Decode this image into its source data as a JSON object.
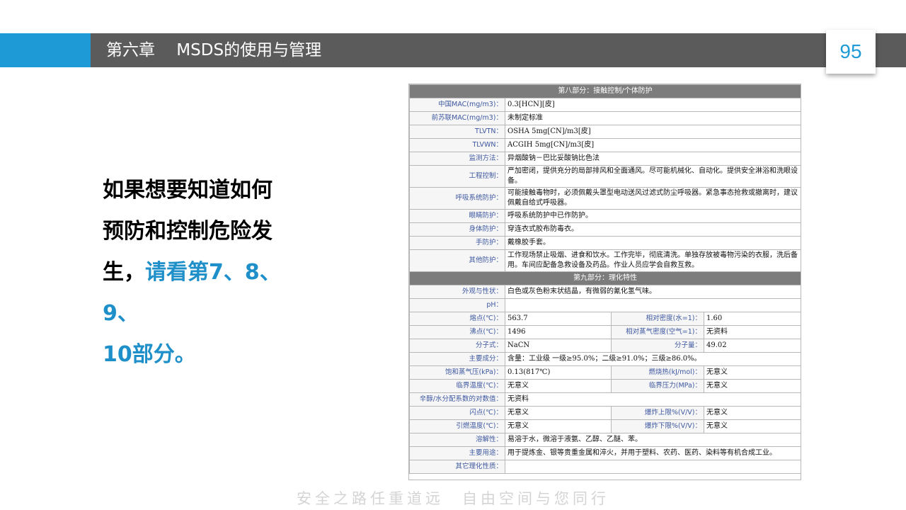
{
  "header": {
    "chapter_title": "第六章　 MSDS的使用与管理",
    "page_number": "95"
  },
  "main_text": {
    "line1": "如果想要知道如何",
    "line2": "预防和控制危险发",
    "line3_plain": "生，",
    "line3_highlight": "请看第7、8、9、",
    "line4_highlight": "10部分。"
  },
  "msds": {
    "section8_title": "第八部分：接触控制/个体防护",
    "section8_rows": [
      {
        "label": "中国MAC(mg/m3)：",
        "value": "0.3[HCN][皮]"
      },
      {
        "label": "前苏联MAC(mg/m3)：",
        "value": "未制定标准"
      },
      {
        "label": "TLVTN：",
        "value": "OSHA 5mg[CN]/m3[皮]"
      },
      {
        "label": "TLVWN：",
        "value": "ACGIH 5mg[CN]/m3[皮]"
      },
      {
        "label": "监测方法：",
        "value": "异烟酸钠－巴比妥酸钠比色法"
      },
      {
        "label": "工程控制：",
        "value": "严加密闭，提供充分的局部排风和全面通风。尽可能机械化、自动化。提供安全淋浴和洗眼设备。"
      },
      {
        "label": "呼吸系统防护：",
        "value": "可能接触毒物时，必须佩戴头罩型电动送风过滤式防尘呼吸器。紧急事态抢救或撤离时，建议佩戴自给式呼吸器。"
      },
      {
        "label": "眼睛防护：",
        "value": "呼吸系统防护中已作防护。"
      },
      {
        "label": "身体防护：",
        "value": "穿连衣式胶布防毒衣。"
      },
      {
        "label": "手防护：",
        "value": "戴橡胶手套。"
      },
      {
        "label": "其他防护：",
        "value": "工作现场禁止吸烟、进食和饮水。工作完毕，彻底清洗。单独存放被毒物污染的衣服，洗后备用。车间应配备急救设备及药品。作业人员应学会自救互救。"
      }
    ],
    "section9_title": "第九部分：理化特性",
    "appearance": {
      "label": "外观与性状：",
      "value": "白色或灰色粉末状结晶，有微弱的氰化氢气味。"
    },
    "ph": {
      "label": "pH：",
      "value": ""
    },
    "pair_rows": [
      {
        "l1": "熔点(℃)：",
        "v1": "563.7",
        "l2": "相对密度(水=1)：",
        "v2": "1.60"
      },
      {
        "l1": "沸点(℃)：",
        "v1": "1496",
        "l2": "相对蒸气密度(空气=1)：",
        "v2": "无资料"
      },
      {
        "l1": "分子式：",
        "v1": "NaCN",
        "l2": "分子量：",
        "v2": "49.02"
      }
    ],
    "composition": {
      "label": "主要成分：",
      "value": "含量：工业级 一级≥95.0%；二级≥91.0%；三级≥86.0%。"
    },
    "pair_rows2": [
      {
        "l1": "饱和蒸气压(kPa)：",
        "v1": "0.13(817℃)",
        "l2": "燃烧热(kJ/mol)：",
        "v2": "无意义"
      },
      {
        "l1": "临界温度(℃)：",
        "v1": "无意义",
        "l2": "临界压力(MPa)：",
        "v2": "无意义"
      }
    ],
    "octanol": {
      "label": "辛醇/水分配系数的对数值：",
      "value": "无资料"
    },
    "pair_rows3": [
      {
        "l1": "闪点(℃)：",
        "v1": "无意义",
        "l2": "爆炸上限%(V/V)：",
        "v2": "无意义"
      },
      {
        "l1": "引燃温度(℃)：",
        "v1": "无意义",
        "l2": "爆炸下限%(V/V)：",
        "v2": "无意义"
      }
    ],
    "solubility": {
      "label": "溶解性：",
      "value": "易溶于水，微溶于液氨、乙醇、乙醚、苯。"
    },
    "usage": {
      "label": "主要用途：",
      "value": "用于提炼金、银等贵重金属和淬火，并用于塑料、农药、医药、染料等有机合成工业。"
    },
    "other": {
      "label": "其它理化性质：",
      "value": ""
    }
  },
  "footer": {
    "slogan": "安全之路任重道远　自由空间与您同行"
  }
}
